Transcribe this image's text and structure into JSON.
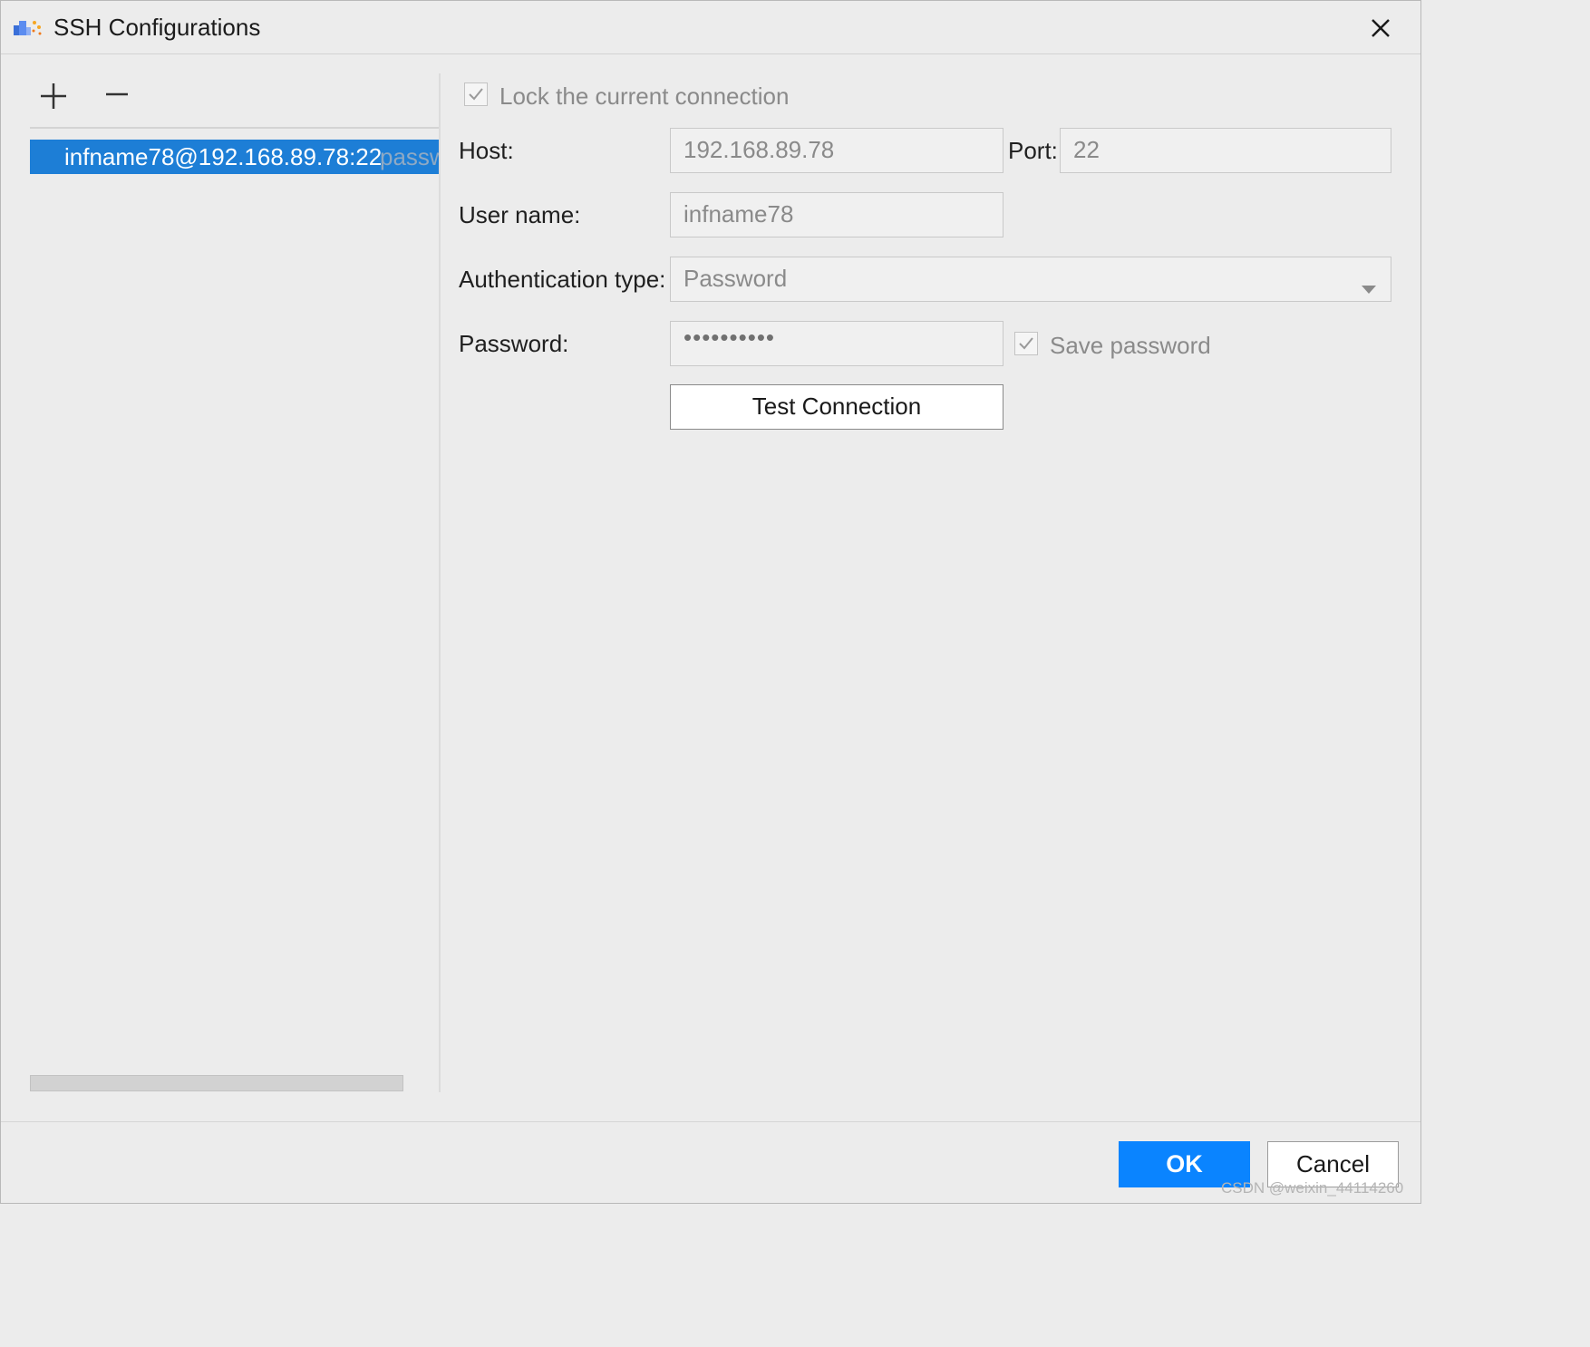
{
  "window": {
    "title": "SSH Configurations",
    "app_icon": "cloud-sparkle-icon",
    "close_icon": "close-icon"
  },
  "left_panel": {
    "add_icon": "plus-icon",
    "remove_icon": "minus-icon",
    "items": [
      {
        "label": "infname78@192.168.89.78:22",
        "auth_hint": "password",
        "selected": true
      }
    ]
  },
  "form": {
    "lock_label": "Lock the current connection",
    "lock_checked": true,
    "host_label": "Host:",
    "host_value": "192.168.89.78",
    "port_label": "Port:",
    "port_value": "22",
    "username_label": "User name:",
    "username_value": "infname78",
    "auth_label": "Authentication type:",
    "auth_value": "Password",
    "password_label": "Password:",
    "password_value": "••••••••••",
    "save_password_label": "Save password",
    "save_password_checked": true,
    "test_button": "Test Connection"
  },
  "footer": {
    "ok_label": "OK",
    "cancel_label": "Cancel",
    "watermark": "CSDN @weixin_44114260"
  },
  "colors": {
    "selection": "#1d7ed6",
    "primary_button": "#0a84ff",
    "dialog_bg": "#ececec"
  }
}
